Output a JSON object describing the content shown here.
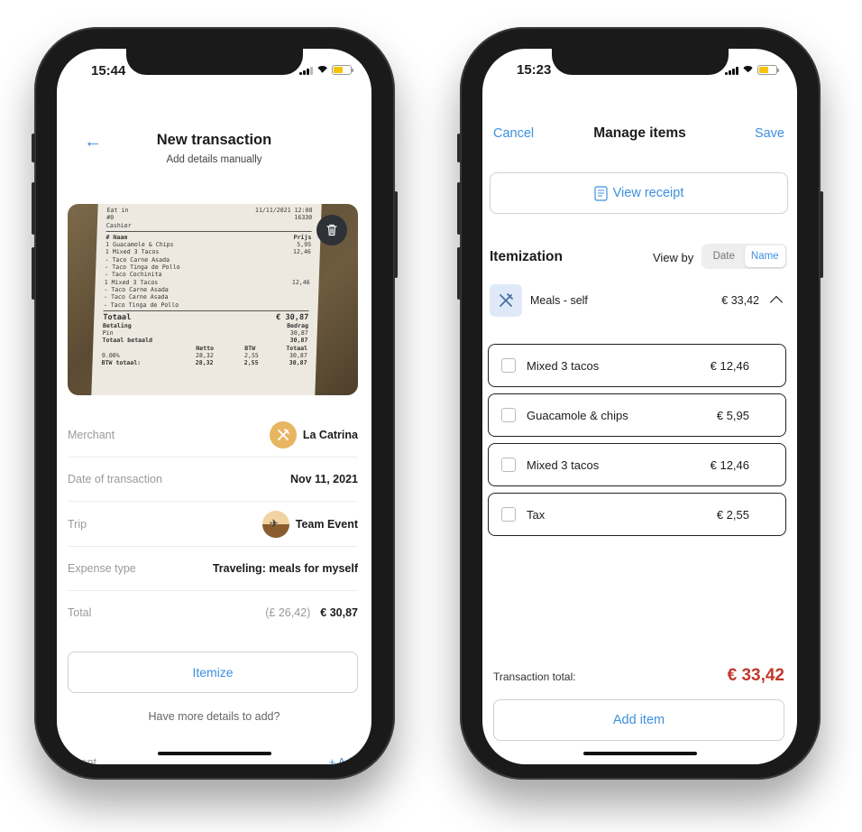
{
  "left_phone": {
    "status_time": "15:44",
    "header": {
      "title": "New transaction",
      "subtitle": "Add details manually"
    },
    "receipt_text": {
      "top_left": [
        "Eat in",
        "#0",
        "Cashier"
      ],
      "top_right": [
        "11/11/2021 12:08",
        "16330"
      ],
      "header_left": "# Naam",
      "header_right": "Prijs",
      "lines": [
        {
          "text": "1  Guacamole & Chips",
          "price": "5,95"
        },
        {
          "text": "1  Mixed 3 Tacos",
          "price": "12,46"
        },
        {
          "text": "  - Taco Carne Asada",
          "price": ""
        },
        {
          "text": "  - Taco Tinga de Pollo",
          "price": ""
        },
        {
          "text": "  - Taco Cochinita",
          "price": ""
        },
        {
          "text": "1  Mixed 3 Tacos",
          "price": "12,46"
        },
        {
          "text": "  - Taco Carne Asada",
          "price": ""
        },
        {
          "text": "  - Taco Carne Asada",
          "price": ""
        },
        {
          "text": "  - Taco Tinga de Pollo",
          "price": ""
        }
      ],
      "totaal_label": "Totaal",
      "totaal_value": "€ 30,87",
      "betaling_label": "Betaling",
      "bedrag_label": "Bedrag",
      "pin_label": "Pin",
      "pin_value": "30,87",
      "totaal_betaald_label": "Totaal betaald",
      "totaal_betaald_value": "30,87",
      "tax_header": [
        "",
        "Netto",
        "BTW",
        "Totaal"
      ],
      "tax_row": [
        "9.00%",
        "28,32",
        "2,55",
        "30,87"
      ],
      "tax_total": [
        "BTW totaal:",
        "28,32",
        "2,55",
        "30,87"
      ]
    },
    "details": [
      {
        "label": "Merchant",
        "value": "La Catrina"
      },
      {
        "label": "Date of transaction",
        "value": "Nov 11, 2021"
      },
      {
        "label": "Trip",
        "value": "Team Event"
      },
      {
        "label": "Expense type",
        "value": "Traveling: meals for myself"
      },
      {
        "label": "Total",
        "muted": "(£ 26,42)",
        "value": "€ 30,87"
      }
    ],
    "itemize_label": "Itemize",
    "more_details": "Have more details to add?",
    "event_label": "Event",
    "event_add": "+ Add"
  },
  "right_phone": {
    "status_time": "15:23",
    "nav": {
      "cancel": "Cancel",
      "title": "Manage items",
      "save": "Save"
    },
    "view_receipt": "View receipt",
    "itemization_title": "Itemization",
    "view_by_label": "View by",
    "view_by_options": [
      "Date",
      "Name"
    ],
    "view_by_selected": "Name",
    "category": {
      "name": "Meals - self",
      "amount": "€ 33,42"
    },
    "items": [
      {
        "name": "Mixed 3 tacos",
        "price": "€ 12,46"
      },
      {
        "name": "Guacamole & chips",
        "price": "€ 5,95"
      },
      {
        "name": "Mixed 3 tacos",
        "price": "€ 12,46"
      },
      {
        "name": "Tax",
        "price": "€ 2,55"
      }
    ],
    "transaction_total_label": "Transaction total:",
    "transaction_total_value": "€ 33,42",
    "add_item": "Add item"
  },
  "colors": {
    "accent": "#3d8fe0",
    "total_red": "#c0392b",
    "merchant_avatar": "#e8b560"
  }
}
